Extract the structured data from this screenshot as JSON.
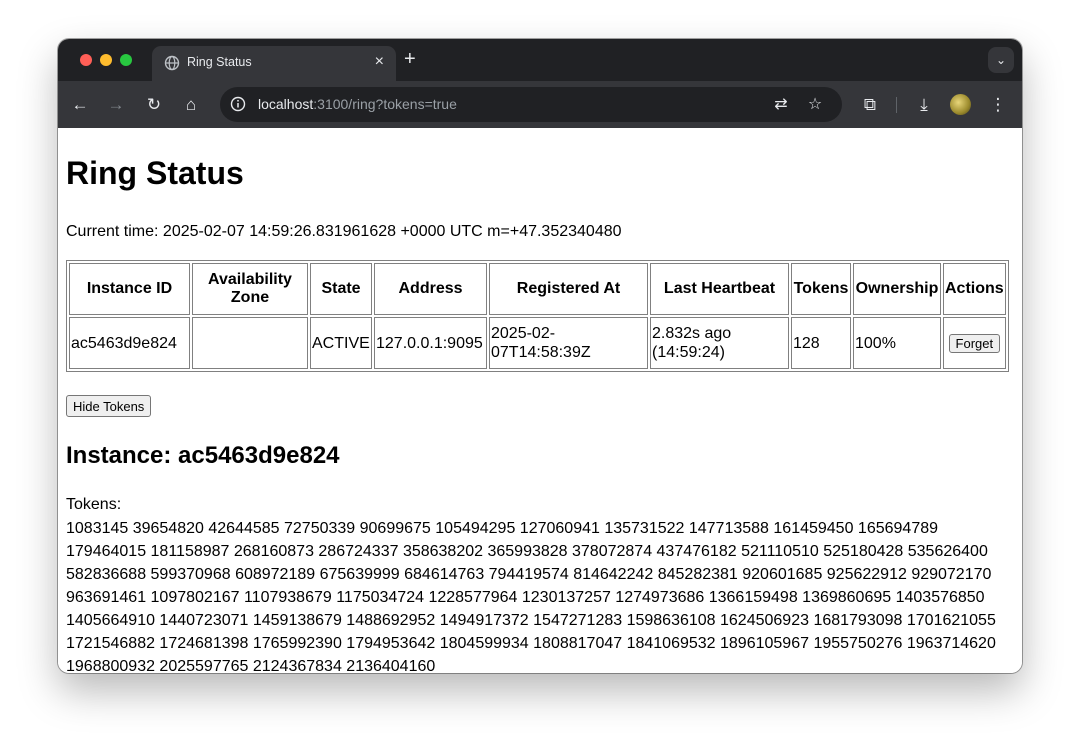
{
  "browser": {
    "tab_title": "Ring Status",
    "tab_close": "×",
    "new_tab": "+",
    "url_host": "localhost",
    "url_rest": ":3100/ring?tokens=true"
  },
  "page": {
    "title": "Ring Status",
    "current_time": "Current time: 2025-02-07 14:59:26.831961628 +0000 UTC m=+47.352340480",
    "table": {
      "headers": [
        "Instance ID",
        "Availability Zone",
        "State",
        "Address",
        "Registered At",
        "Last Heartbeat",
        "Tokens",
        "Ownership",
        "Actions"
      ],
      "rows": [
        {
          "instance_id": "ac5463d9e824",
          "zone": "",
          "state": "ACTIVE",
          "address": "127.0.0.1:9095",
          "registered_at": "2025-02-07T14:58:39Z",
          "last_heartbeat": "2.832s ago (14:59:24)",
          "tokens": "128",
          "ownership": "100%",
          "action_label": "Forget"
        }
      ]
    },
    "hide_tokens_label": "Hide Tokens",
    "instance_heading": "Instance: ac5463d9e824",
    "tokens_label": "Tokens:",
    "tokens": "1083145 39654820 42644585 72750339 90699675 105494295 127060941 135731522 147713588 161459450 165694789 179464015 181158987 268160873 286724337 358638202 365993828 378072874 437476182 521110510 525180428 535626400 582836688 599370968 608972189 675639999 684614763 794419574 814642242 845282381 920601685 925622912 929072170 963691461 1097802167 1107938679 1175034724 1228577964 1230137257 1274973686 1366159498 1369860695 1403576850 1405664910 1440723071 1459138679 1488692952 1494917372 1547271283 1598636108 1624506923 1681793098 1701621055 1721546882 1724681398 1765992390 1794953642 1804599934 1808817047 1841069532 1896105967 1955750276 1963714620 1968800932 2025597765 2124367834 2136404160"
  }
}
